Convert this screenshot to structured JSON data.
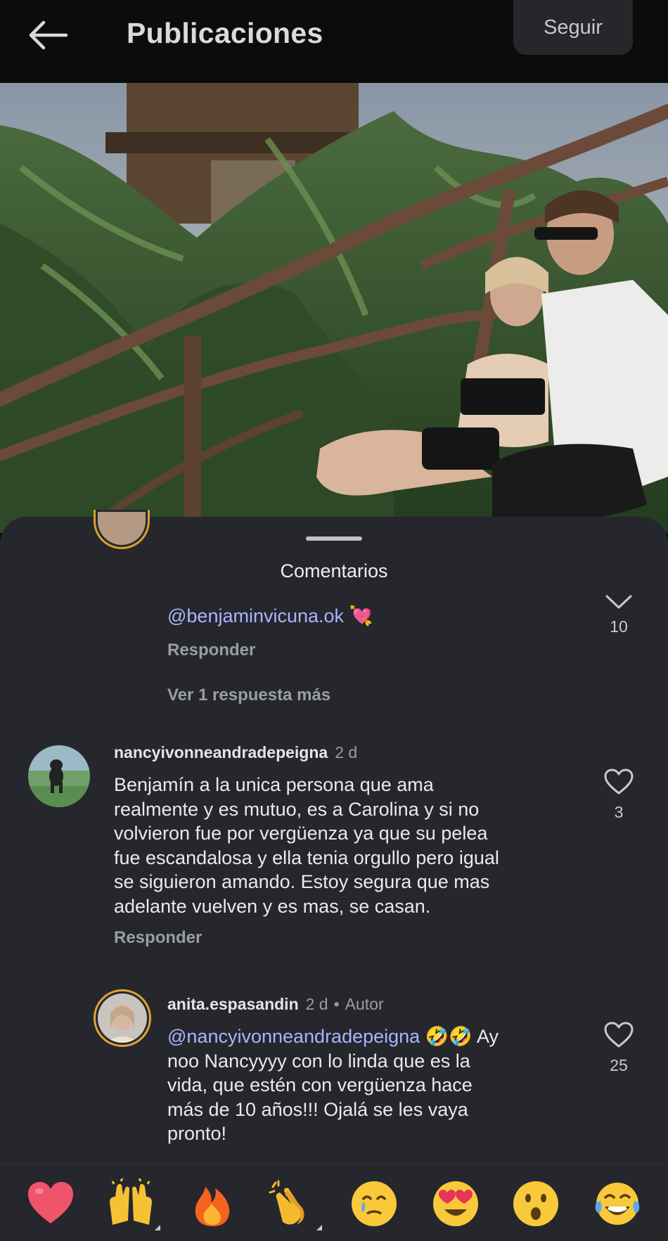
{
  "header": {
    "title": "Publicaciones",
    "follow_label": "Seguir"
  },
  "sheet": {
    "title": "Comentarios"
  },
  "thread": {
    "top_comment": {
      "mention": "@benjaminvicuna.ok",
      "emoji": "💘",
      "reply_label": "Responder",
      "like_count": "10",
      "more_replies": "Ver 1 respuesta más"
    },
    "comment_nancy": {
      "username": "nancyivonneandradepeigna",
      "time": "2 d",
      "lines": [
        "Benjamín  a la unica persona que ama",
        "realmente  y es mutuo, es a Carolina y si no",
        "volvieron fue por vergüenza  ya que su pelea",
        "fue escandalosa y ella tenia orgullo pero igual",
        "se siguieron amando. Estoy segura que mas",
        "adelante vuelven y es mas, se casan."
      ],
      "reply_label": "Responder",
      "like_count": "3"
    },
    "reply_anita": {
      "username": "anita.espasandin",
      "time": "2 d",
      "author_badge": "Autor",
      "mention": "@nancyivonneandradepeigna",
      "emoji": "🤣🤣",
      "line1_tail": "Ay",
      "lines": [
        "noo Nancyyyy con lo linda que es la",
        "vida, que estén con vergüenza hace",
        "más de 10 años!!! Ojalá se les vaya",
        "pronto!"
      ],
      "like_count": "25"
    }
  },
  "reactions": [
    {
      "emoji": "❤️",
      "name": "heart"
    },
    {
      "emoji": "🙌",
      "name": "raised-hands"
    },
    {
      "emoji": "🔥",
      "name": "fire"
    },
    {
      "emoji": "👏",
      "name": "clapping-hands"
    },
    {
      "emoji": "🥲",
      "name": "smiling-tear"
    },
    {
      "emoji": "😍",
      "name": "heart-eyes"
    },
    {
      "emoji": "😮",
      "name": "surprised"
    },
    {
      "emoji": "😂",
      "name": "tears-of-joy"
    }
  ],
  "colors": {
    "background": "#0c0c0d",
    "sheet": "#25272d",
    "mention": "#a9b4ff",
    "muted": "#9a9da4"
  }
}
